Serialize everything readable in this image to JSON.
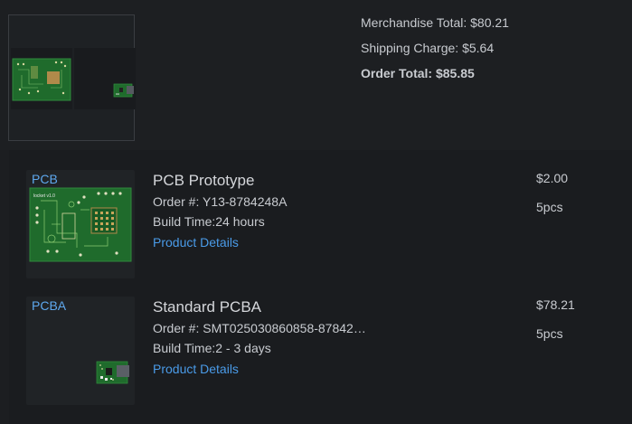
{
  "summary": {
    "merchandise_total": "Merchandise Total: $80.21",
    "shipping_charge": "Shipping Charge: $5.64",
    "order_total": "Order Total: $85.85"
  },
  "items": [
    {
      "tag": "PCB",
      "title": "PCB Prototype",
      "order_number": "Order #: Y13-8784248A",
      "build_time": "Build Time:24 hours",
      "details_link": "Product Details",
      "price": "$2.00",
      "quantity": "5pcs"
    },
    {
      "tag": "PCBA",
      "title": "Standard PCBA",
      "order_number": "Order #: SMT025030860858-87842…",
      "build_time": "Build Time:2 - 3 days",
      "details_link": "Product Details",
      "price": "$78.21",
      "quantity": "5pcs"
    }
  ],
  "colors": {
    "background": "#1c1e21",
    "link": "#4a9be8",
    "tag": "#5ea8ee",
    "pcb_green": "#1f6b2c"
  },
  "icons": [
    "pcb-board-image",
    "pcba-board-image"
  ]
}
